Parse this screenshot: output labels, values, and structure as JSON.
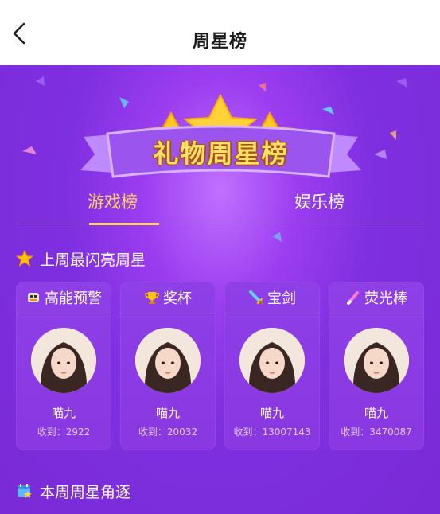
{
  "nav": {
    "title": "周星榜",
    "back_icon": "back-chevron-icon"
  },
  "banner": {
    "title": "礼物周星榜"
  },
  "tabs": [
    {
      "label": "游戏榜",
      "active": true
    },
    {
      "label": "娱乐榜",
      "active": false
    }
  ],
  "sections": {
    "last_week": "上周最闪亮周星",
    "this_week": "本周周星角逐"
  },
  "cards": [
    {
      "gift": "高能预警",
      "icon": "robot-icon",
      "nick": "喵九",
      "received": "收到：2922"
    },
    {
      "gift": "奖杯",
      "icon": "trophy-icon",
      "nick": "喵九",
      "received": "收到：20032"
    },
    {
      "gift": "宝剑",
      "icon": "sword-icon",
      "nick": "喵九",
      "received": "收到：13007143"
    },
    {
      "gift": "荧光棒",
      "icon": "glowstick-icon",
      "nick": "喵九",
      "received": "收到：3470087"
    }
  ],
  "colors": {
    "background": "#7a2fd8",
    "accent": "#ffd45a",
    "card": "#8e3fe6"
  }
}
